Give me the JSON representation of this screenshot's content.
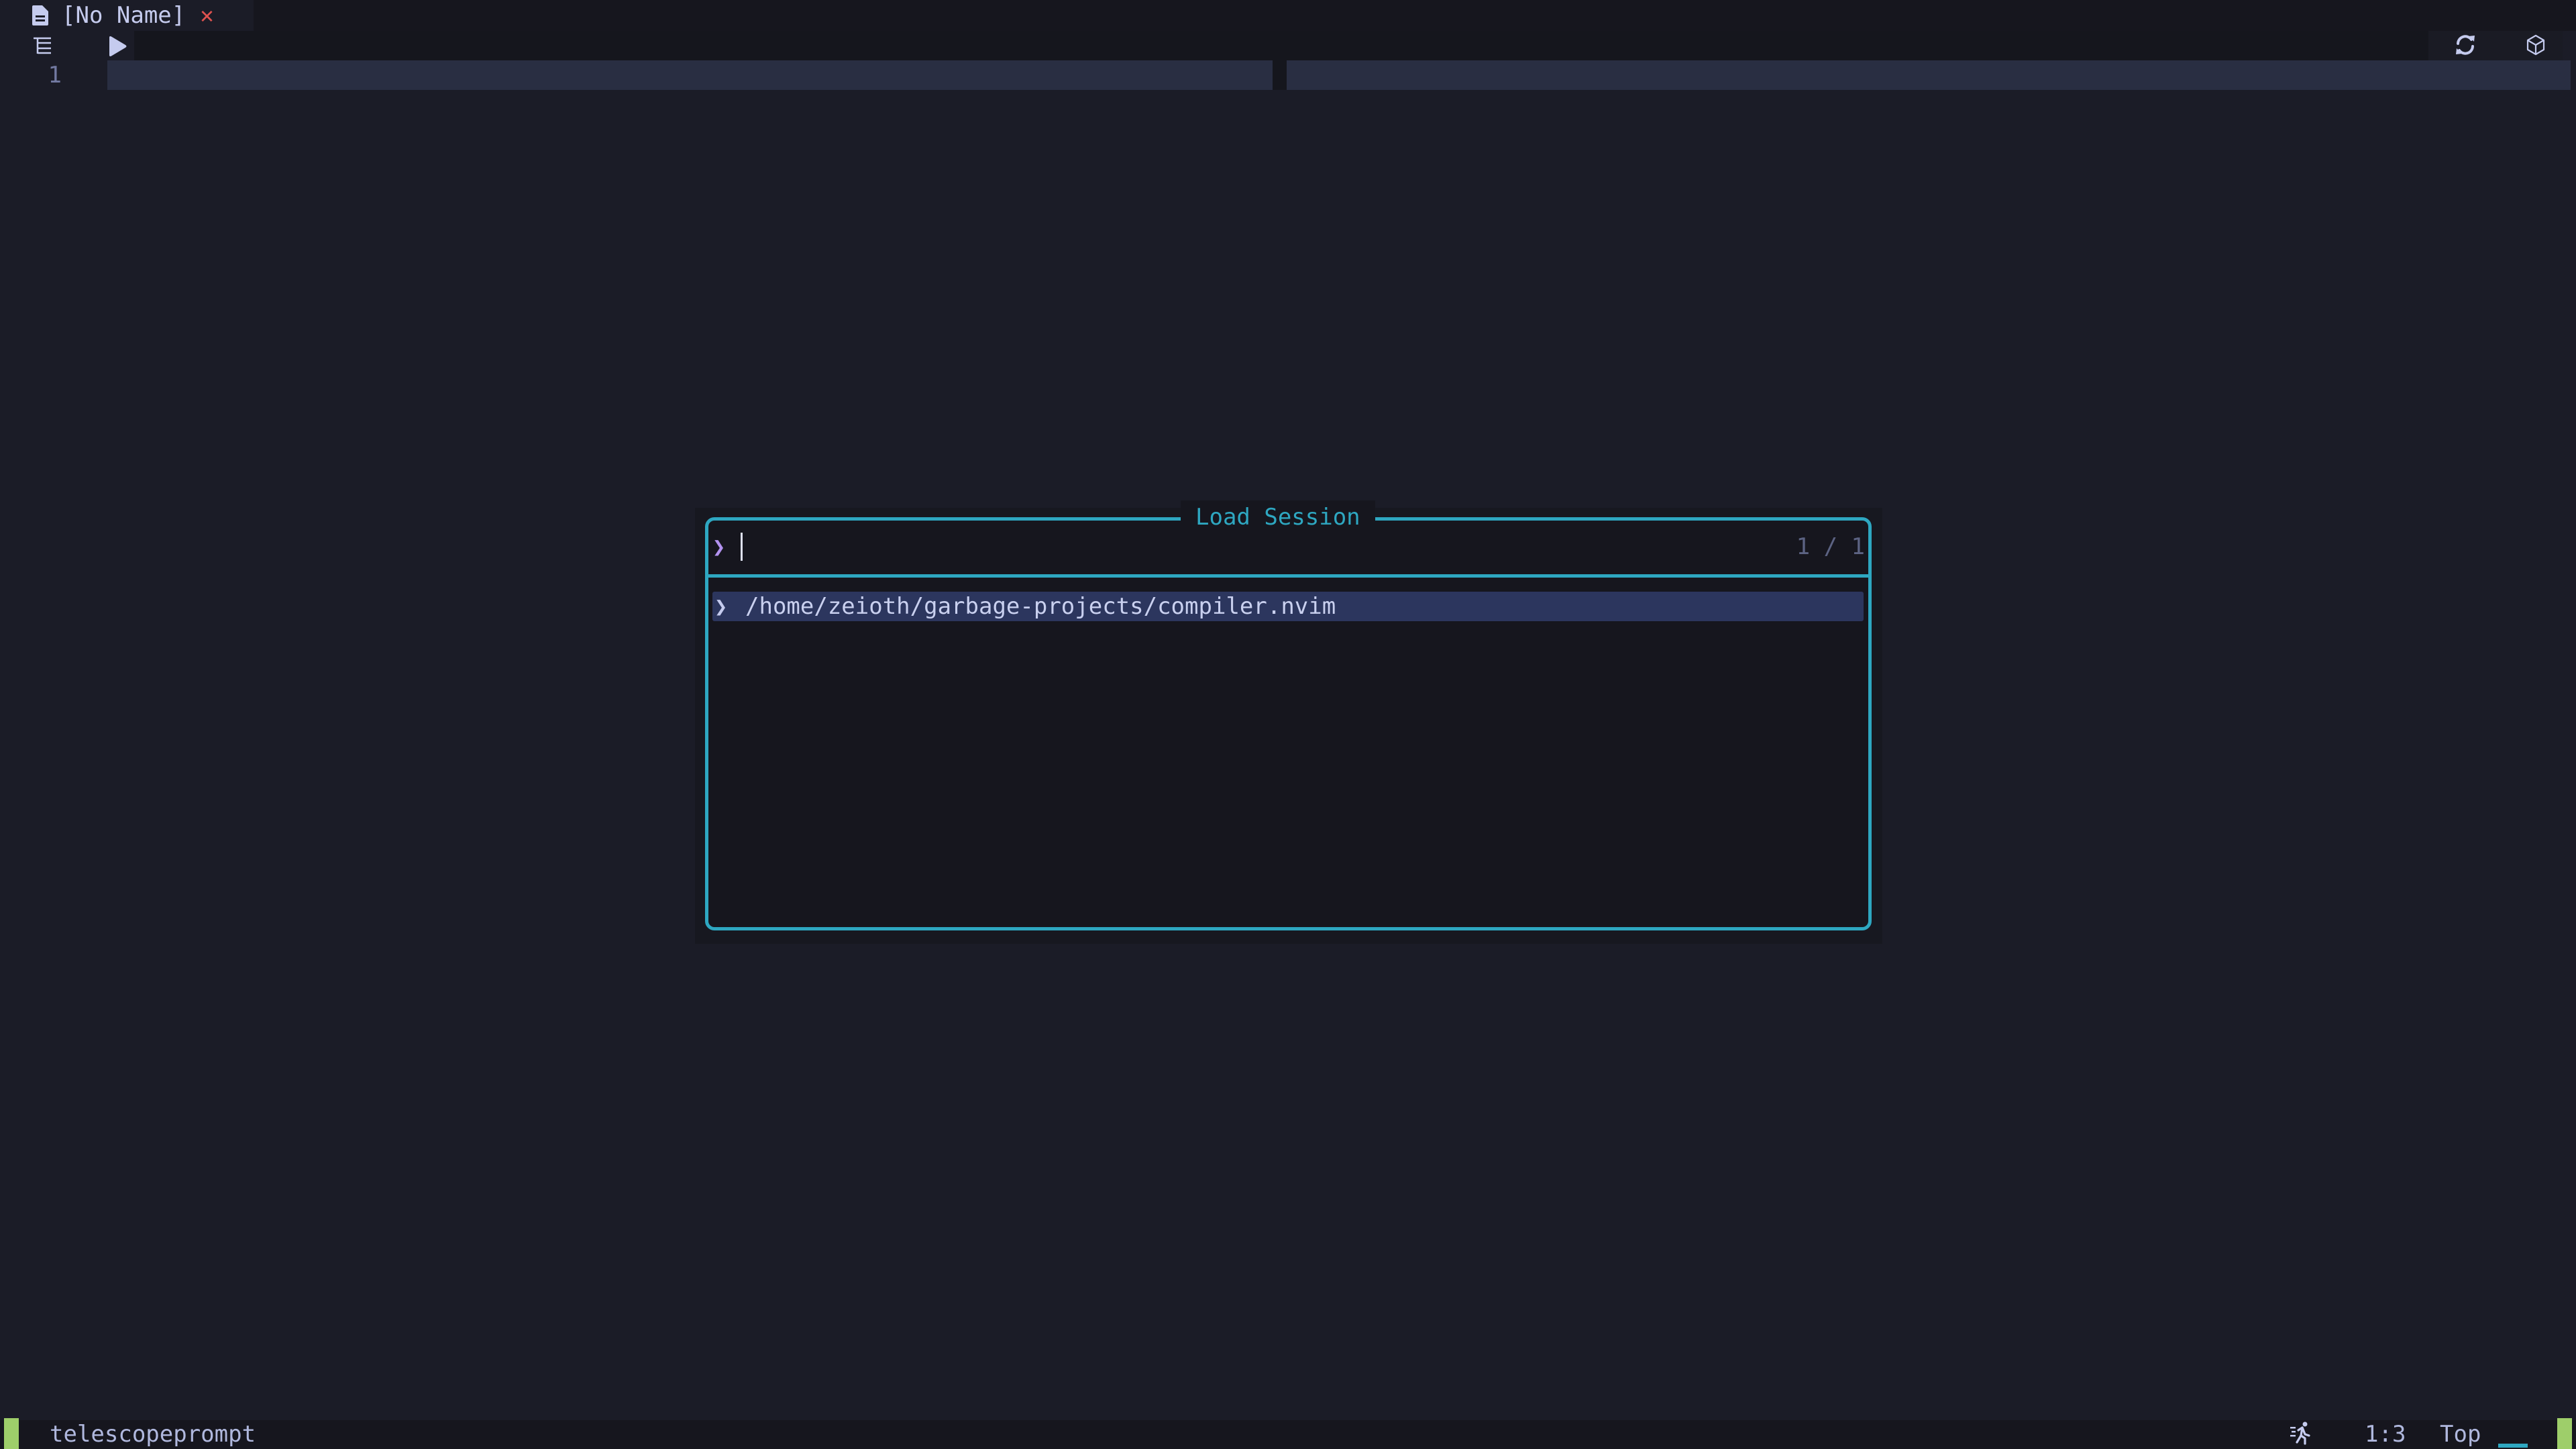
{
  "tabline": {
    "tabs": [
      {
        "title": "[No Name]",
        "icon": "file-icon",
        "close_icon": "close-icon",
        "close_glyph": "✕"
      }
    ]
  },
  "winbar": {
    "left_icons": [
      "outline-icon",
      "play-icon"
    ],
    "right_icons": [
      "refresh-icon",
      "package-icon"
    ]
  },
  "editor": {
    "line_numbers": [
      "1"
    ],
    "splits": 2
  },
  "telescope": {
    "title": "Load Session",
    "prompt_prefix": "❯",
    "prompt_value": "",
    "counter": "1 / 1",
    "results": [
      {
        "selected": true,
        "caret": "❯",
        "text": "/home/zeioth/garbage-projects/compiler.nvim"
      }
    ]
  },
  "statusbar": {
    "filetype": "telescopeprompt",
    "run_icon": "running-icon",
    "position": "1:3",
    "scroll": "Top",
    "accent_colors": {
      "mode": "#9ece6a",
      "border": "#2ea7c1",
      "close": "#e0524f"
    }
  }
}
